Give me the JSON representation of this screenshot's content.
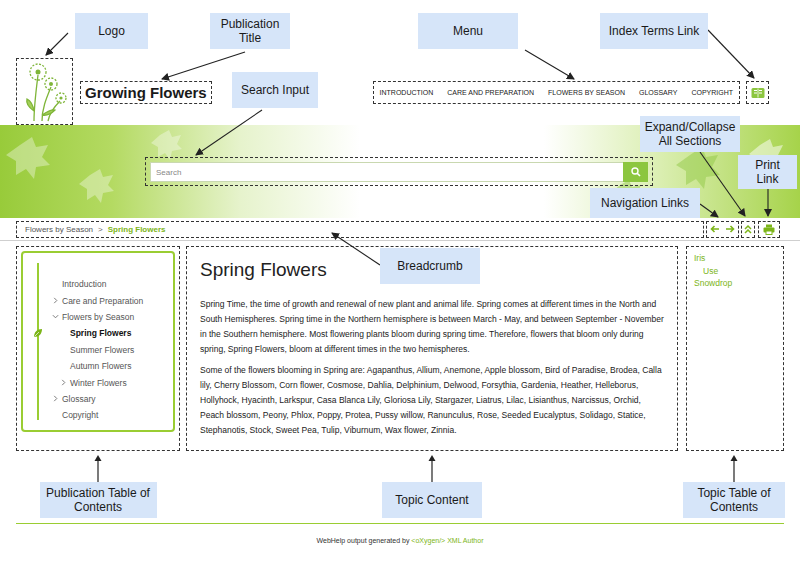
{
  "callouts": [
    {
      "label": "Logo"
    },
    {
      "label": "Publication Title"
    },
    {
      "label": "Menu"
    },
    {
      "label": "Index Terms Link"
    },
    {
      "label": "Search Input"
    },
    {
      "label": "Expand/Collapse All Sections"
    },
    {
      "label": "Print Link"
    },
    {
      "label": "Navigation Links"
    },
    {
      "label": "Breadcrumb"
    }
  ],
  "section_callouts": [
    {
      "label": "Publication Table of Contents"
    },
    {
      "label": "Topic Content"
    },
    {
      "label": "Topic Table of Contents"
    }
  ],
  "publication_title": "Growing Flowers",
  "menu": [
    "INTRODUCTION",
    "CARE AND PREPARATION",
    "FLOWERS BY SEASON",
    "GLOSSARY",
    "COPYRIGHT"
  ],
  "search": {
    "placeholder": "Search"
  },
  "breadcrumb": {
    "separator": ">",
    "items": [
      {
        "label": "Flowers by Season",
        "selected": false
      },
      {
        "label": "Spring Flowers",
        "selected": true
      }
    ]
  },
  "toc": [
    {
      "label": "Introduction",
      "level": 0,
      "has_children": false,
      "expanded": false,
      "selected": false
    },
    {
      "label": "Care and Preparation",
      "level": 0,
      "has_children": true,
      "expanded": false,
      "selected": false
    },
    {
      "label": "Flowers by Season",
      "level": 0,
      "has_children": true,
      "expanded": true,
      "selected": false
    },
    {
      "label": "Spring Flowers",
      "level": 1,
      "has_children": false,
      "expanded": false,
      "selected": true
    },
    {
      "label": "Summer Flowers",
      "level": 1,
      "has_children": false,
      "expanded": false,
      "selected": false
    },
    {
      "label": "Autumn Flowers",
      "level": 1,
      "has_children": false,
      "expanded": false,
      "selected": false
    },
    {
      "label": "Winter Flowers",
      "level": 1,
      "has_children": true,
      "expanded": false,
      "selected": false
    },
    {
      "label": "Glossary",
      "level": 0,
      "has_children": true,
      "expanded": false,
      "selected": false
    },
    {
      "label": "Copyright",
      "level": 0,
      "has_children": false,
      "expanded": false,
      "selected": false
    }
  ],
  "topic": {
    "title": "Spring Flowers",
    "paragraphs": [
      "Spring Time, the time of growth and renewal of new plant and animal life. Spring comes at different times in the North and South Hemispheres. Spring time in the Northern hemisphere is between March - May, and between September - November in the Southern hemisphere. Most flowering plants bloom during spring time. Therefore, flowers that bloom only during spring, Spring Flowers, bloom at different times in the two hemispheres.",
      "Some of the flowers blooming in Spring are: Agapanthus, Allium, Anemone, Apple blossom, Bird of Paradise, Brodea, Calla lily, Cherry Blossom, Corn flower, Cosmose, Dahlia, Delphinium, Delwood, Forsythia, Gardenia, Heather, Helleborus, Hollyhock, Hyacinth, Larkspur, Casa Blanca Lily, Gloriosa Lily, Stargazer, Liatrus, Lilac, Lisianthus, Narcissus, Orchid, Peach blossom, Peony, Phlox, Poppy, Protea, Pussy willow, Ranunculus, Rose, Seeded Eucalyptus, Solidago, Statice, Stephanotis, Stock, Sweet Pea, Tulip, Viburnum, Wax flower, Zinnia."
    ]
  },
  "topic_toc": [
    {
      "label": "Iris",
      "level": 0
    },
    {
      "label": "Use",
      "level": 1
    },
    {
      "label": "Snowdrop",
      "level": 0
    }
  ],
  "footer": {
    "prefix": "WebHelp output generated by ",
    "link": "<oXygen/> XML Author"
  }
}
